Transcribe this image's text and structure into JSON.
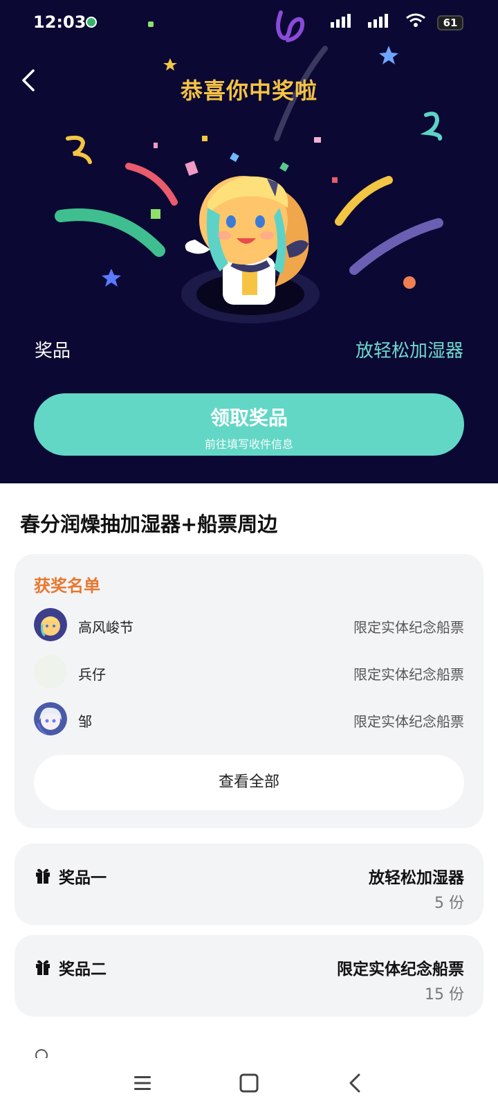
{
  "status_bar": {
    "time": "12:03",
    "battery": "61"
  },
  "header": {
    "title": "恭喜你中奖啦"
  },
  "prize_summary": {
    "label": "奖品",
    "value": "放轻松加湿器"
  },
  "claim_button": {
    "label": "领取奖品",
    "sublabel": "前往填写收件信息"
  },
  "activity": {
    "title": "春分润燥抽加湿器+船票周边"
  },
  "winners": {
    "heading": "获奖名单",
    "rows": [
      {
        "name": "高风峻节",
        "prize": "限定实体纪念船票"
      },
      {
        "name": "兵仔",
        "prize": "限定实体纪念船票"
      },
      {
        "name": "邹",
        "prize": "限定实体纪念船票"
      }
    ],
    "view_all": "查看全部"
  },
  "prizes": [
    {
      "tier": "奖品一",
      "name": "放轻松加湿器",
      "quantity": "5 份"
    },
    {
      "tier": "奖品二",
      "name": "限定实体纪念船票",
      "quantity": "15 份"
    }
  ],
  "colors": {
    "hero_background": "#0b0933",
    "title_gold": "#f6c343",
    "accent_teal": "#63d7c6",
    "winners_orange": "#e8772e"
  },
  "icons": [
    "back-arrow-icon",
    "gift-icon",
    "menu-icon",
    "home-square-icon",
    "nav-back-icon"
  ]
}
